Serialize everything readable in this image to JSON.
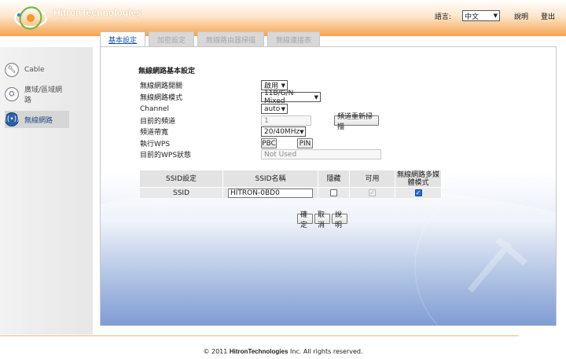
{
  "header": {
    "brand": "HitronTechnologies",
    "language_label": "語言:",
    "language_value": "中文",
    "help": "說明",
    "logout": "登出"
  },
  "nav": {
    "items": [
      {
        "label": "Cable",
        "icon": "cable-icon"
      },
      {
        "label": "廣域/區域網路",
        "icon": "network-icon"
      },
      {
        "label": "無線網路",
        "icon": "wireless-icon",
        "active": true
      }
    ]
  },
  "tabs": [
    "基本設定",
    "加密設定",
    "無線路由器掃描",
    "無線連接表"
  ],
  "form": {
    "title": "無線網路基本設定",
    "rows": [
      {
        "label": "無線網路開關",
        "value": "啟用"
      },
      {
        "label": "無線網路模式",
        "value": "11B/G/N Mixed"
      },
      {
        "label": "Channel",
        "value": "auto"
      },
      {
        "label": "目前的頻道",
        "value": "1",
        "button": "頻道重新掃描"
      },
      {
        "label": "頻道帶寬",
        "value": "20/40MHz"
      },
      {
        "label": "執行WPS",
        "btn_pbc": "PBC",
        "btn_pin": "PIN"
      },
      {
        "label": "目前的WPS狀態",
        "value": "Not Used"
      }
    ]
  },
  "ssid_table": {
    "headers": [
      "SSID設定",
      "SSID名稱",
      "隱藏",
      "可用",
      "無線網路多媒體模式"
    ],
    "row": {
      "label": "SSID",
      "name": "HITRON-0BD0",
      "hidden": false,
      "enabled": true,
      "wmm": true
    }
  },
  "actions": {
    "ok": "確定",
    "cancel": "取消",
    "help": "說明"
  },
  "footer": {
    "prefix": "© 2011",
    "brand": "HitronTechnologies",
    "suffix": "Inc.  All rights reserved."
  },
  "colors": {
    "accent_orange": "#f6a24e",
    "link_blue": "#1a55a8",
    "panel_blue": "#3c68bd"
  }
}
